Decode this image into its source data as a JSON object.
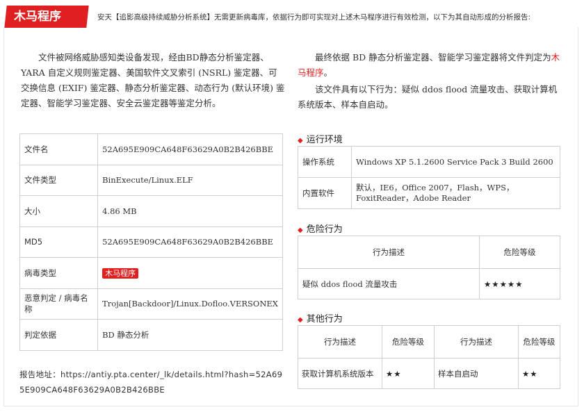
{
  "header": {
    "tag": "木马程序",
    "description": "安天【追影高级持续威胁分析系统】无需更新病毒库，依据行为即可实现对上述木马程序进行有效检测，以下为其自动形成的分析报告:"
  },
  "intro": {
    "left": "文件被网络威胁感知类设备发现，经由BD静态分析鉴定器、YARA 自定义规则鉴定器、美国软件文叉索引 (NSRL) 鉴定器、可交换信息 (EXIF) 鉴定器、静态分析鉴定器、动态行为 (默认环境) 鉴定器、智能学习鉴定器、安全云鉴定器等鉴定分析。",
    "right_prefix": "最终依据 BD 静态分析鉴定器、智能学习鉴定器将文件判定为",
    "right_verdict": "木马程序",
    "right_suffix": "。",
    "behavior": "该文件具有以下行为：疑似 ddos flood 流量攻击、获取计算机系统版本、样本自启动。"
  },
  "file_info": [
    {
      "key": "文件名",
      "value": "52A695E909CA648F63629A0B2B426BBE"
    },
    {
      "key": "文件类型",
      "value": "BinExecute/Linux.ELF"
    },
    {
      "key": "大小",
      "value": "4.86 MB"
    },
    {
      "key": "MD5",
      "value": "52A695E909CA648F63629A0B2B426BBE"
    },
    {
      "key": "病毒类型",
      "value": "木马程序"
    },
    {
      "key": "恶意判定 / 病毒名称",
      "value": "Trojan[Backdoor]/Linux.Dofloo.VERSONEX"
    },
    {
      "key": "判定依据",
      "value": "BD 静态分析"
    }
  ],
  "report": {
    "label": "报告地址：",
    "url": "https://antiy.pta.center/_lk/details.html?hash=52A695E909CA648F63629A0B2B426BBE"
  },
  "env": {
    "title": "运行环境",
    "rows": [
      {
        "key": "操作系统",
        "value": "Windows XP 5.1.2600 Service Pack 3 Build 2600"
      },
      {
        "key": "内置软件",
        "value": "默认，IE6，Office 2007，Flash，WPS，FoxitReader，Adobe Reader"
      }
    ]
  },
  "risk": {
    "title": "危险行为",
    "col_desc": "行为描述",
    "col_level": "危险等级",
    "rows": [
      {
        "desc": "疑似 ddos flood 流量攻击",
        "level": "★★★★★"
      }
    ]
  },
  "other": {
    "title": "其他行为",
    "col_desc": "行为描述",
    "col_level": "危险等级",
    "rows": [
      {
        "desc1": "获取计算机系统版本",
        "level1": "★★",
        "desc2": "样本自启动",
        "level2": "★★"
      }
    ]
  }
}
